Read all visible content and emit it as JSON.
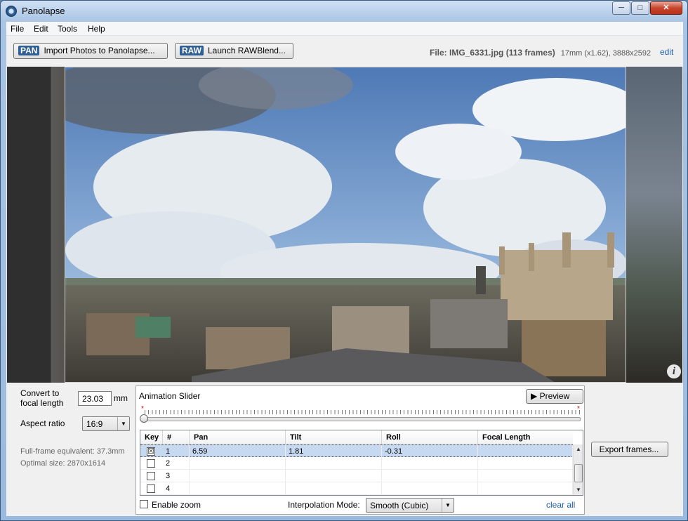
{
  "window": {
    "title": "Panolapse",
    "controls": {
      "minimize": "─",
      "maximize": "□",
      "close": "✕"
    },
    "accent": "#2f5f95"
  },
  "menu": [
    "File",
    "Edit",
    "Tools",
    "Help"
  ],
  "toolbar": {
    "import_tag": "PAN",
    "import_label": "Import Photos to Panolapse...",
    "raw_tag": "RAW",
    "raw_label": "Launch RAWBlend...",
    "file_info": "File: IMG_6331.jpg (113 frames)",
    "lens_info": "17mm (x1.62), 3888x2592",
    "edit_link": "edit"
  },
  "viewer": {
    "info_icon": "i"
  },
  "settings": {
    "focal_label": "Convert to focal length",
    "focal_value": "23.03",
    "focal_unit": "mm",
    "aspect_label": "Aspect ratio",
    "aspect_value": "16:9",
    "fullframe": "Full-frame equivalent: 37.3mm",
    "optimal": "Optimal size: 2870x1614"
  },
  "animation": {
    "title": "Animation Slider",
    "preview_label": "Preview",
    "slider_position": 0,
    "star": "*",
    "columns": [
      "Key",
      "#",
      "Pan",
      "Tilt",
      "Roll",
      "Focal Length"
    ],
    "rows": [
      {
        "key": "☒",
        "num": "1",
        "pan": "6.59",
        "tilt": "1.81",
        "roll": "-0.31",
        "focal": ""
      },
      {
        "key": "",
        "num": "2",
        "pan": "",
        "tilt": "",
        "roll": "",
        "focal": ""
      },
      {
        "key": "",
        "num": "3",
        "pan": "",
        "tilt": "",
        "roll": "",
        "focal": ""
      },
      {
        "key": "",
        "num": "4",
        "pan": "",
        "tilt": "",
        "roll": "",
        "focal": ""
      }
    ],
    "enable_zoom_label": "Enable zoom",
    "interp_label": "Interpolation Mode:",
    "interp_value": "Smooth (Cubic)",
    "clear_all": "clear all"
  },
  "export_label": "Export frames..."
}
